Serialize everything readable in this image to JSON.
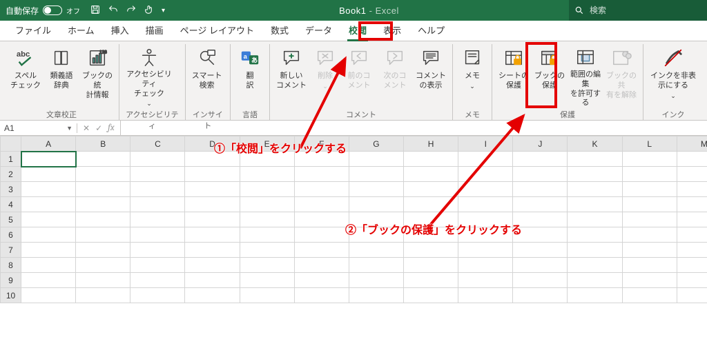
{
  "titlebar": {
    "autosave_label": "自動保存",
    "autosave_state": "オフ",
    "doc": "Book1",
    "app": "Excel",
    "search_placeholder": "検索"
  },
  "tabs": [
    "ファイル",
    "ホーム",
    "挿入",
    "描画",
    "ページ レイアウト",
    "数式",
    "データ",
    "校閲",
    "表示",
    "ヘルプ"
  ],
  "active_tab": "校閲",
  "ribbon": {
    "groups": [
      {
        "label": "文章校正",
        "buttons": [
          {
            "name": "spell",
            "label": "スペル チェック",
            "icon": "abc"
          },
          {
            "name": "thesaurus",
            "label": "類義語 辞典",
            "icon": "book"
          },
          {
            "name": "stats",
            "label": "ブックの統 計情報",
            "icon": "stats"
          }
        ]
      },
      {
        "label": "アクセシビリティ",
        "buttons": [
          {
            "name": "a11y",
            "label": "アクセシビリティ チェック",
            "icon": "a11y",
            "dd": true,
            "wide": true
          }
        ]
      },
      {
        "label": "インサイト",
        "buttons": [
          {
            "name": "smart",
            "label": "スマート 検索",
            "icon": "search"
          }
        ]
      },
      {
        "label": "言語",
        "buttons": [
          {
            "name": "translate",
            "label": "翻 訳",
            "icon": "translate",
            "narrow": true
          }
        ]
      },
      {
        "label": "コメント",
        "buttons": [
          {
            "name": "newcomment",
            "label": "新しい コメント",
            "icon": "comment-plus"
          },
          {
            "name": "delcomment",
            "label": "削除",
            "icon": "comment-x",
            "dd": true,
            "disabled": true,
            "narrow": true
          },
          {
            "name": "prevcomment",
            "label": "前のコ メント",
            "icon": "comment-prev",
            "disabled": true
          },
          {
            "name": "nextcomment",
            "label": "次のコ メント",
            "icon": "comment-next",
            "disabled": true
          },
          {
            "name": "showcomment",
            "label": "コメント の表示",
            "icon": "comment-list"
          }
        ]
      },
      {
        "label": "メモ",
        "buttons": [
          {
            "name": "memo",
            "label": "メモ",
            "icon": "memo",
            "dd": true,
            "narrow": true
          }
        ]
      },
      {
        "label": "保護",
        "buttons": [
          {
            "name": "protectsheet",
            "label": "シートの 保護",
            "icon": "protect-sheet"
          },
          {
            "name": "protectbook",
            "label": "ブックの 保護",
            "icon": "protect-book"
          },
          {
            "name": "alloweditranges",
            "label": "範囲の編集 を許可する",
            "icon": "range"
          },
          {
            "name": "unshare",
            "label": "ブックの共 有を解除",
            "icon": "unshare",
            "disabled": true
          }
        ]
      },
      {
        "label": "インク",
        "buttons": [
          {
            "name": "hideink",
            "label": "インクを非表 示にする",
            "icon": "ink",
            "dd": true,
            "wide": true
          }
        ]
      }
    ]
  },
  "namebox": "A1",
  "columns": [
    "A",
    "B",
    "C",
    "D",
    "E",
    "F",
    "G",
    "H",
    "I",
    "J",
    "K",
    "L",
    "M"
  ],
  "rows": [
    1,
    2,
    3,
    4,
    5,
    6,
    7,
    8,
    9,
    10
  ],
  "annotations": {
    "a1": "①「校閲」をクリックする",
    "a2": "②「ブックの保護」をクリックする"
  }
}
